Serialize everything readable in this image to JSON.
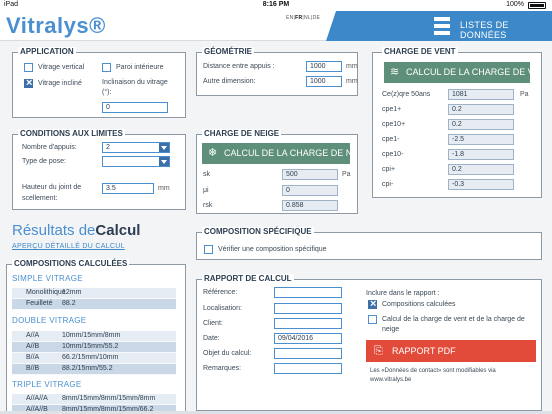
{
  "status": {
    "carrier": "iPad",
    "time": "8:16 PM",
    "battery": "100%"
  },
  "header": {
    "logo": "Vitralys®",
    "lang_en": "EN",
    "lang_fr": "FR",
    "lang_nl": "NL",
    "lang_de": "DE",
    "data_lists": "LISTES DE DONNÉES"
  },
  "application": {
    "title": "APPLICATION",
    "vertical": "Vitrage vertical",
    "inclined": "Vitrage incliné",
    "interior": "Paroi intérieure",
    "inclination_label1": "Inclinaison du vitrage",
    "inclination_label2": "(°):",
    "inclination_value": "0"
  },
  "geometry": {
    "title": "GÉOMÉTRIE",
    "distance_label": "Distance entre appuis :",
    "distance_value": "1000",
    "other_label": "Autre dimension:",
    "other_value": "1000",
    "unit": "mm"
  },
  "wind": {
    "title": "CHARGE DE VENT",
    "button": "CALCUL DE LA CHARGE DE VENT",
    "rows": [
      {
        "label": "Ce(z)qre 50ans",
        "value": "1081",
        "unit": "Pa"
      },
      {
        "label": "cpe1+",
        "value": "0.2",
        "unit": ""
      },
      {
        "label": "cpe10+",
        "value": "0.2",
        "unit": ""
      },
      {
        "label": "cpe1-",
        "value": "-2.5",
        "unit": ""
      },
      {
        "label": "cpe10-",
        "value": "-1.8",
        "unit": ""
      },
      {
        "label": "cpi+",
        "value": "0.2",
        "unit": ""
      },
      {
        "label": "cpi-",
        "value": "-0.3",
        "unit": ""
      }
    ]
  },
  "limits": {
    "title": "CONDITIONS AUX LIMITES",
    "supports_label": "Nombre d'appuis:",
    "supports_value": "2",
    "pose_label": "Type de pose:",
    "pose_value": "",
    "joint_label1": "Hauteur du joint de",
    "joint_label2": "scellement:",
    "joint_value": "3.5",
    "unit": "mm"
  },
  "snow": {
    "title": "CHARGE DE NEIGE",
    "button": "CALCUL DE LA CHARGE DE NEIGE",
    "sk_label": "sk",
    "sk_value": "500",
    "sk_unit": "Pa",
    "mu_label": "μi",
    "mu_value": "0",
    "rsk_label": "rsk",
    "rsk_value": "0.858"
  },
  "results": {
    "title_a": "Résultats de",
    "title_b": "Calcul",
    "link": "APERÇU DÉTAILLÉ DU CALCUL"
  },
  "compositions": {
    "title": "COMPOSITIONS CALCULÉES",
    "simple_title": "SIMPLE VITRAGE",
    "simple": [
      {
        "a": "Monolithique",
        "b": "12mm"
      },
      {
        "a": "Feuilleté",
        "b": "88.2"
      }
    ],
    "double_title": "DOUBLE VITRAGE",
    "double": [
      {
        "a": "A//A",
        "b": "10mm/15mm/8mm"
      },
      {
        "a": "A//B",
        "b": "10mm/15mm/55.2"
      },
      {
        "a": "B//A",
        "b": "66.2/15mm/10mm"
      },
      {
        "a": "B//B",
        "b": "88.2/15mm/55.2"
      }
    ],
    "triple_title": "TRIPLE VITRAGE",
    "triple": [
      {
        "a": "A//A//A",
        "b": "8mm/15mm/8mm/15mm/8mm"
      },
      {
        "a": "A//A//B",
        "b": "8mm/15mm/8mm/15mm/66.2"
      }
    ]
  },
  "specific": {
    "title": "COMPOSITION SPÉCIFIQUE",
    "check_label": "Vérifier une composition spécifique"
  },
  "report": {
    "title": "RAPPORT DE CALCUL",
    "reference": "Référence:",
    "location": "Localisation:",
    "client": "Client:",
    "date": "Date:",
    "date_value": "09/04/2016",
    "object": "Objet du calcul:",
    "remarks": "Remarques:",
    "include_label": "Inclure dans le rapport :",
    "opt1": "Compositions calculées",
    "opt2_line1": "Calcul de la charge de vent et de la charge de",
    "opt2_line2": "neige",
    "pdf_button": "RAPPORT PDF",
    "note1": "Les «Données de contact» sont modifiables via",
    "note2": "www.vitralys.be"
  },
  "colors": {
    "accent": "#4a8fd0",
    "button_green": "#5e8f7a",
    "button_red": "#e24b3a",
    "header_blue": "#3d88c8"
  }
}
